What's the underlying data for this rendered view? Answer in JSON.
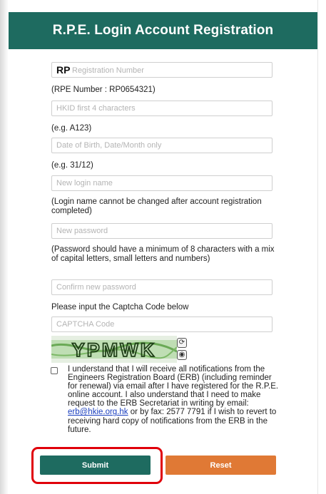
{
  "header": {
    "title": "R.P.E. Login Account Registration"
  },
  "fields": {
    "rpe_number": {
      "prefix": "RP",
      "placeholder": "Registration Number",
      "hint": "(RPE Number : RP0654321)"
    },
    "hkid": {
      "placeholder": "HKID first 4 characters",
      "hint": "(e.g. A123)"
    },
    "dob": {
      "placeholder": "Date of Birth, Date/Month only",
      "hint": "(e.g. 31/12)"
    },
    "login_name": {
      "placeholder": "New login name",
      "hint": "(Login name cannot be changed after account registration completed)"
    },
    "password": {
      "placeholder": "New password",
      "hint": "(Password should have a minimum of 8 characters with a mix of capital letters, small letters and numbers)"
    },
    "confirm_password": {
      "placeholder": "Confirm new password"
    },
    "captcha": {
      "label": "Please input the Captcha Code below",
      "placeholder": "CAPTCHA Code",
      "image_text": "YPMWK"
    }
  },
  "consent": {
    "checked": false,
    "text_before": "I understand that I will receive all notifications from the Engineers Registration Board (ERB) (including reminder for renewal) via email after I have registered for the R.P.E. online account. I also understand that I need to make request to the ERB Secretariat in writing by email:",
    "email": "erb@hkie.org.hk",
    "text_after": "or by fax: 2577 7791 if I wish to revert to receiving hard copy of notifications from the ERB in the future."
  },
  "buttons": {
    "submit": "Submit",
    "reset": "Reset"
  },
  "colors": {
    "primary": "#1e6b60",
    "reset": "#e07935",
    "highlight": "#e0000a"
  },
  "icons": {
    "refresh": "refresh-icon",
    "audio": "audio-icon"
  }
}
